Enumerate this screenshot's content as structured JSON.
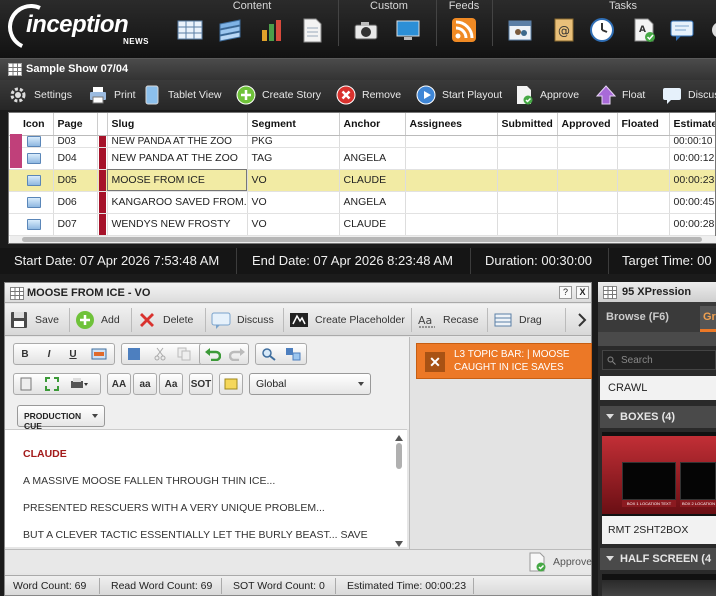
{
  "app": {
    "logo_text": "inception",
    "logo_sub": "NEWS"
  },
  "topbar": {
    "groups": [
      {
        "label": "Content"
      },
      {
        "label": "Custom"
      },
      {
        "label": "Feeds"
      },
      {
        "label": "Tasks"
      }
    ]
  },
  "show": {
    "title": "Sample Show 07/04"
  },
  "toolbar": {
    "settings": "Settings",
    "print": "Print",
    "tablet_view": "Tablet View",
    "create_story": "Create Story",
    "remove": "Remove",
    "start_playout": "Start Playout",
    "approve": "Approve",
    "float": "Float",
    "discuss": "Discus"
  },
  "grid": {
    "columns": [
      "Icon",
      "Page",
      "Slug",
      "Segment",
      "Anchor",
      "Assignees",
      "Submitted",
      "Approved",
      "Floated",
      "Estimated"
    ],
    "rows": [
      {
        "page": "D03",
        "slug": "NEW PANDA AT THE ZOO",
        "segment": "PKG",
        "anchor": "",
        "estimated": "00:00:10"
      },
      {
        "page": "D04",
        "slug": "NEW PANDA AT THE ZOO",
        "segment": "TAG",
        "anchor": "ANGELA",
        "estimated": "00:00:12"
      },
      {
        "page": "D05",
        "slug": "MOOSE FROM ICE",
        "segment": "VO",
        "anchor": "CLAUDE",
        "estimated": "00:00:23"
      },
      {
        "page": "D06",
        "slug": "KANGAROO SAVED FROM...",
        "segment": "VO",
        "anchor": "ANGELA",
        "estimated": "00:00:45"
      },
      {
        "page": "D07",
        "slug": "WENDYS NEW FROSTY",
        "segment": "VO",
        "anchor": "CLAUDE",
        "estimated": "00:00:28"
      }
    ]
  },
  "datebar": {
    "start": "Start Date: 07 Apr 2026 7:53:48 AM",
    "end": "End Date: 07 Apr 2026 8:23:48 AM",
    "duration": "Duration: 00:30:00",
    "target": "Target Time: 00"
  },
  "editor": {
    "title": "MOOSE FROM ICE - VO",
    "help": "?",
    "close": "X",
    "buttons": {
      "save": "Save",
      "add": "Add",
      "delete": "Delete",
      "discuss": "Discuss",
      "create_placeholder": "Create Placeholder",
      "recase": "Recase",
      "drag": "Drag"
    },
    "format": {
      "bold": "B",
      "italic": "I",
      "underline": "U",
      "upper": "AA",
      "lower": "aa",
      "title": "Aa",
      "sot": "SOT",
      "style_select": "Global",
      "production_cue": "PRODUCTION CUE"
    },
    "script": {
      "speaker": "CLAUDE",
      "lines": [
        "A MASSIVE MOOSE FALLEN THROUGH THIN ICE...",
        "PRESENTED RESCUERS WITH A VERY UNIQUE PROBLEM...",
        "BUT A CLEVER TACTIC ESSENTIALLY LET THE BURLY BEAST... SAVE"
      ]
    },
    "cue": {
      "line1": "L3 TOPIC BAR: | MOOSE",
      "line2": "CAUGHT IN ICE SAVES"
    },
    "approve": "Approve",
    "status": {
      "word_count": "Word Count: 69",
      "read_word_count": "Read Word Count: 69",
      "sot_word_count": "SOT Word Count: 0",
      "estimated_time": "Estimated Time: 00:00:23"
    }
  },
  "xpression": {
    "title": "95 XPression",
    "tab_browse": "Browse (F6)",
    "tab_next": "Gr",
    "search_placeholder": "Search",
    "crawl": "CRAWL",
    "boxes_header": "BOXES (4)",
    "thumb_caption": "RMT 2SHT2BOX",
    "half_screen_header": "HALF SCREEN (4",
    "thumb_box1": "BOX 1 LOCATION TEXT",
    "thumb_box2": "BOX 2 LOCATION TEXT"
  },
  "colors": {
    "accent_orange": "#ec7826",
    "selected_row": "#f2eba4",
    "speaker_red": "#a31a1a"
  }
}
